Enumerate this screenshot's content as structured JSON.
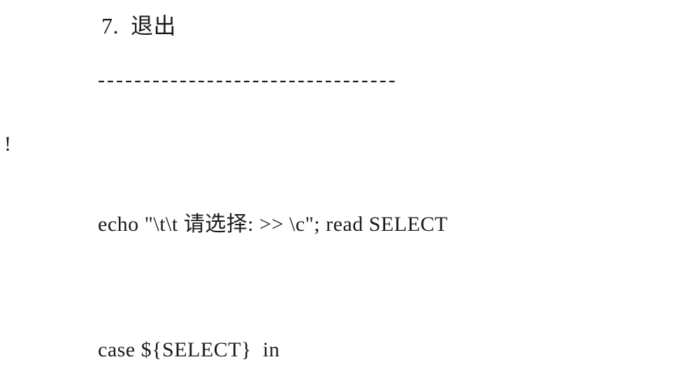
{
  "lines": {
    "menu_item": "7.  退出",
    "divider": "---------------------------------",
    "heredoc_end": "!",
    "echo_read": "echo \"\\t\\t 请选择: >> \\c\"; read SELECT",
    "case_start": "case ${SELECT}  in"
  }
}
